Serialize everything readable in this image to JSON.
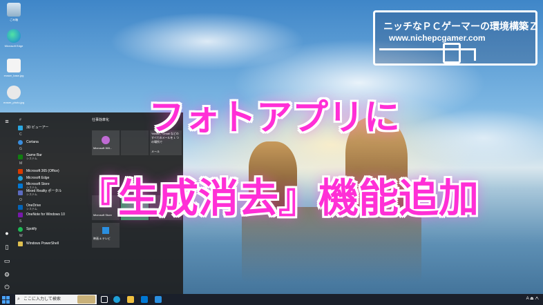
{
  "overlay": {
    "title_line1": "フォトアプリに",
    "title_line2": "『生成消去』機能追加",
    "title_color": "#ff2fd6"
  },
  "logo": {
    "line1": "ニッチなＰＣゲーマーの環境構築Ｚ",
    "line2": "www.nichepcgamer.com"
  },
  "desktop_icons": [
    {
      "name": "recycle-bin",
      "label": "ごみ箱"
    },
    {
      "name": "microsoft-edge",
      "label": "Microsoft Edge"
    },
    {
      "name": "file-a",
      "label": "eraser_base.jpg"
    },
    {
      "name": "file-b",
      "label": "eraser_photo.jpg"
    }
  ],
  "start_menu": {
    "apps": [
      {
        "letter": "#"
      },
      {
        "label": "3D ビューアー",
        "icon_color": "#2aa7e0"
      },
      {
        "letter": "C"
      },
      {
        "label": "Cortana",
        "icon_color": "#3a8dde"
      },
      {
        "letter": "G"
      },
      {
        "label": "Game Bar",
        "sub": "システム",
        "icon_color": "#107c10"
      },
      {
        "letter": "M"
      },
      {
        "label": "Microsoft 365 (Office)",
        "icon_color": "#d83b01"
      },
      {
        "label": "Microsoft Edge",
        "icon_color": "#1fa0d8"
      },
      {
        "label": "Microsoft Store",
        "sub": "システム",
        "icon_color": "#0078d4"
      },
      {
        "label": "Mixed Reality ポータル",
        "sub": "システム",
        "icon_color": "#5c6bc0"
      },
      {
        "letter": "O"
      },
      {
        "label": "OneDrive",
        "sub": "システム",
        "icon_color": "#0364b8"
      },
      {
        "label": "OneNote for Windows 10",
        "icon_color": "#7719aa"
      },
      {
        "letter": "S"
      },
      {
        "label": "Spotify",
        "icon_color": "#1db954"
      },
      {
        "letter": "W"
      },
      {
        "label": "Windows PowerShell",
        "icon_color": "#e0c050"
      }
    ],
    "tiles_header": "仕事効率化",
    "tiles": {
      "office": "Microsoft 365...",
      "mail_top": "Yahoo!、Gmail などの",
      "mail_mid": "すべてのメールを 1 つの場所で",
      "mail": "メール",
      "store": "Microsoft Store",
      "whatsapp": "WhatsApp",
      "movies": "映画 & テレビ"
    }
  },
  "taskbar": {
    "search_placeholder": "ここに入力して検索",
    "tray_text": "A ⏏ ᗅ",
    "colors": {
      "start": "#4aa3ff",
      "bar": "#1a1f2a"
    }
  }
}
